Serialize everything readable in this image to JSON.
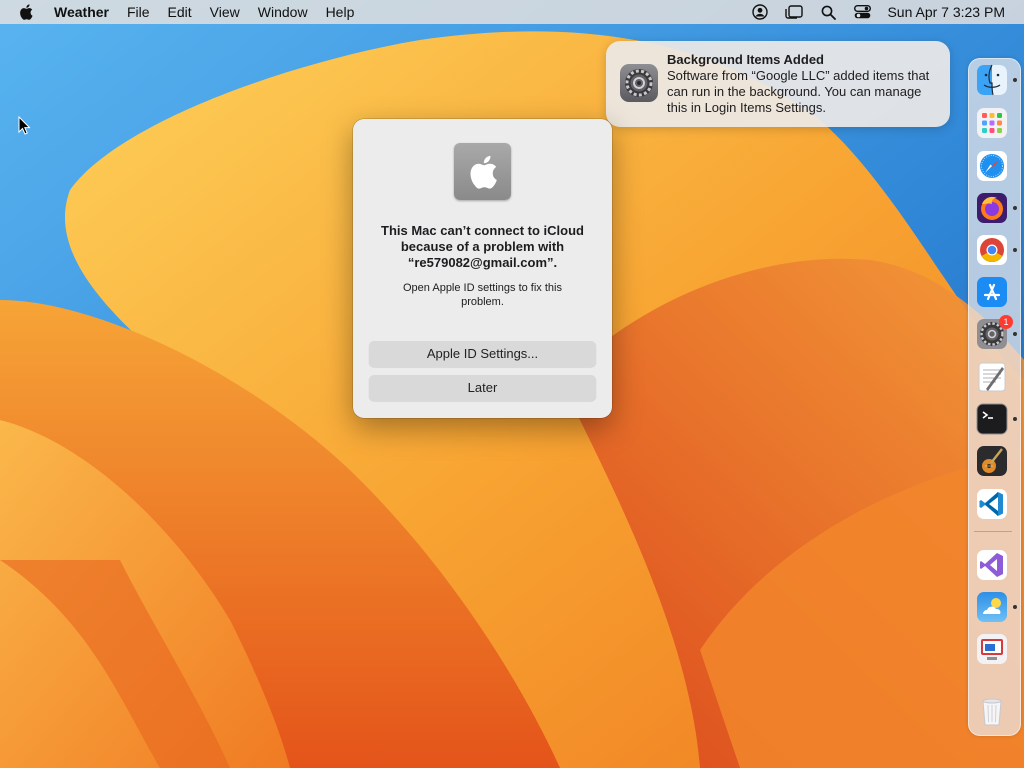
{
  "menubar": {
    "app_name": "Weather",
    "menus": [
      "File",
      "Edit",
      "View",
      "Window",
      "Help"
    ],
    "clock": "Sun Apr 7  3:23 PM",
    "status_icons": [
      "user-account-icon",
      "stage-manager-icon",
      "spotlight-search-icon",
      "control-center-icon"
    ]
  },
  "notification": {
    "title": "Background Items Added",
    "body": "Software from “Google LLC” added items that can run in the background. You can manage this in Login Items Settings.",
    "icon": "system-settings-icon"
  },
  "dialog": {
    "title": "This Mac can’t connect to iCloud because of a problem with “re579082@gmail.com”.",
    "message": "Open Apple ID settings to fix this problem.",
    "primary_button": "Apple ID Settings...",
    "secondary_button": "Later",
    "icon": "apple-logo-icon"
  },
  "dock": {
    "items": [
      {
        "name": "finder",
        "running": true
      },
      {
        "name": "launchpad",
        "running": false
      },
      {
        "name": "safari",
        "running": false
      },
      {
        "name": "firefox",
        "running": true
      },
      {
        "name": "chrome",
        "running": true
      },
      {
        "name": "app-store",
        "running": false
      },
      {
        "name": "system-settings",
        "running": true,
        "badge": "1"
      },
      {
        "name": "textedit",
        "running": false
      },
      {
        "name": "terminal",
        "running": true
      },
      {
        "name": "garageband",
        "running": false
      },
      {
        "name": "vscode",
        "running": false
      },
      {
        "name": "visual-studio",
        "running": false
      },
      {
        "name": "weather",
        "running": true
      },
      {
        "name": "remote-desktop",
        "running": false
      },
      {
        "name": "trash",
        "running": false
      }
    ]
  },
  "colors": {
    "wallpaper_orange": "#f07a1e",
    "wallpaper_yellow": "#fbb33a",
    "wallpaper_blue": "#3a8fd6",
    "badge_red": "#ff3b30"
  }
}
